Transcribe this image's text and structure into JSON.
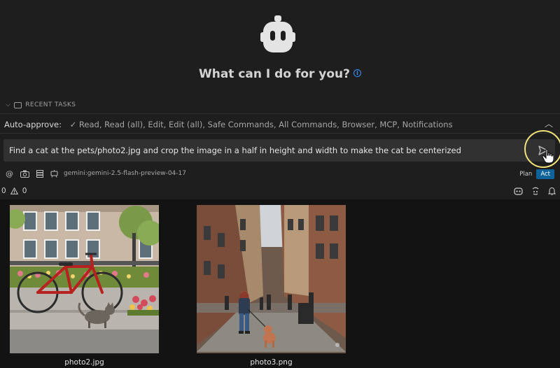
{
  "headline": "What can I do for you?",
  "recent_tasks_label": "RECENT TASKS",
  "auto_approve": {
    "label": "Auto-approve:",
    "values": "✓ Read, Read (all), Edit, Edit (all), Safe Commands, All Commands, Browser, MCP, Notifications"
  },
  "input": {
    "text": "Find a cat at the pets/photo2.jpg and crop the image in a half in height and width to make the cat be centerized"
  },
  "toolbar": {
    "model": "gemini:gemini-2.5-flash-preview-04-17",
    "plan_label": "Plan",
    "act_label": "Act"
  },
  "status": {
    "errors": "0",
    "warnings": "0"
  },
  "gallery": {
    "images": [
      {
        "caption": "photo2.jpg"
      },
      {
        "caption": "photo3.png"
      }
    ]
  },
  "colors": {
    "accent": "#0e639c",
    "info": "#3794ff",
    "highlight": "#f2e27a"
  }
}
